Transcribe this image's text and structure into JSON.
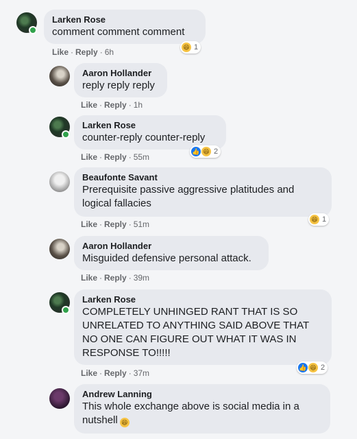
{
  "comments": [
    {
      "author": "Larken Rose",
      "text": "comment comment comment",
      "like": "Like",
      "reply": "Reply",
      "time": "6h",
      "reactions": {
        "count": "1",
        "icons": [
          "haha-icon"
        ]
      }
    },
    {
      "author": "Aaron Hollander",
      "text": "reply reply reply",
      "like": "Like",
      "reply": "Reply",
      "time": "1h"
    },
    {
      "author": "Larken Rose",
      "text": "counter-reply counter-reply",
      "like": "Like",
      "reply": "Reply",
      "time": "55m",
      "reactions": {
        "count": "2",
        "icons": [
          "like-icon",
          "haha-icon"
        ]
      }
    },
    {
      "author": "Beaufonte Savant",
      "text_line1": "Prerequisite passive aggressive platitudes and",
      "text_line2": "logical fallacies",
      "like": "Like",
      "reply": "Reply",
      "time": "51m",
      "reactions": {
        "count": "1",
        "icons": [
          "haha-icon"
        ]
      }
    },
    {
      "author": "Aaron Hollander",
      "text": "Misguided defensive personal attack.",
      "like": "Like",
      "reply": "Reply",
      "time": "39m"
    },
    {
      "author": "Larken Rose",
      "text_line1": "COMPLETELY UNHINGED RANT THAT IS SO",
      "text_line2": "UNRELATED TO ANYTHING SAID ABOVE THAT",
      "text_line3": "NO ONE CAN FIGURE OUT WHAT IT WAS IN",
      "text_line4": "RESPONSE TO!!!!!",
      "like": "Like",
      "reply": "Reply",
      "time": "37m",
      "reactions": {
        "count": "2",
        "icons": [
          "like-icon",
          "haha-icon"
        ]
      }
    },
    {
      "author": "Andrew Lanning",
      "text_line1": "This whole exchange above is social media in a",
      "text_line2": "nutshell",
      "inline_emoji": "haha-icon"
    }
  ],
  "colors": {
    "bubble": "#e7e9ee",
    "like_blue": "#1877f2",
    "haha_yellow": "#f6c343",
    "online_green": "#31a24c"
  }
}
